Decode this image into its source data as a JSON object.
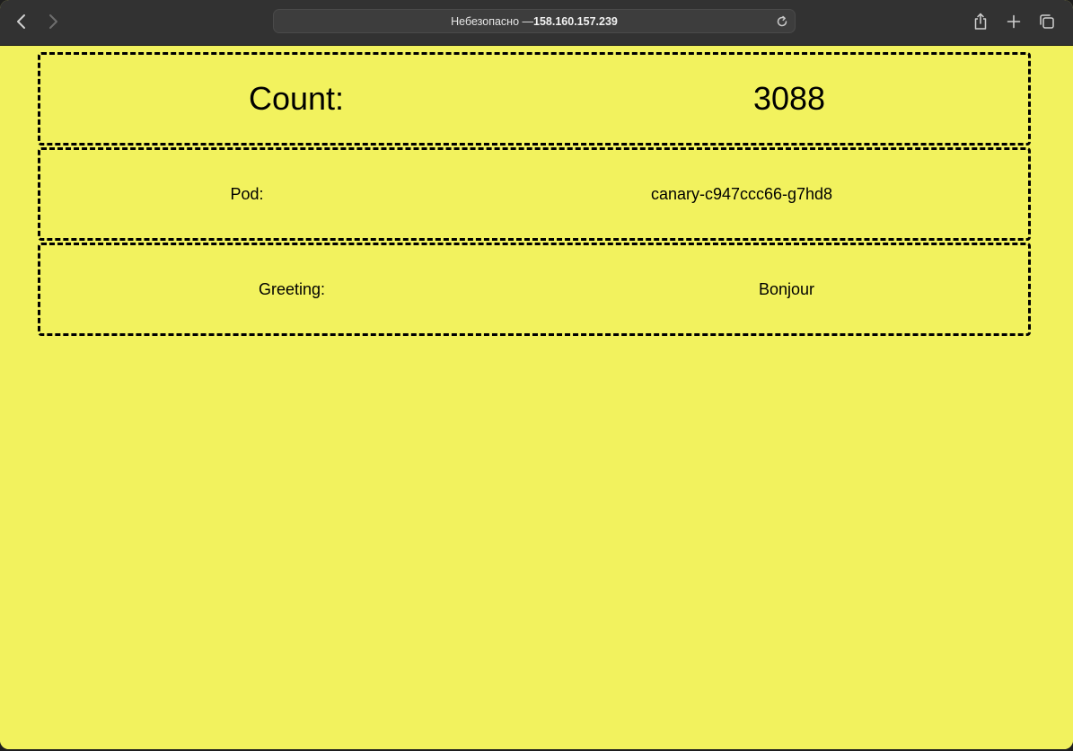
{
  "browser": {
    "address_prefix": "Небезопасно — ",
    "address_host": "158.160.157.239"
  },
  "page": {
    "count_label": "Count:",
    "count_value": "3088",
    "pod_label": "Pod:",
    "pod_value": "canary-c947ccc66-g7hd8",
    "greeting_label": "Greeting:",
    "greeting_value": "Bonjour"
  },
  "colors": {
    "background": "#f2f25e",
    "toolbar": "#323232",
    "border": "#000000"
  },
  "icons": {
    "back": "chevron-left-icon",
    "forward": "chevron-right-icon",
    "reload": "reload-icon",
    "share": "share-icon",
    "new_tab": "plus-icon",
    "tabs": "tabs-overview-icon"
  }
}
